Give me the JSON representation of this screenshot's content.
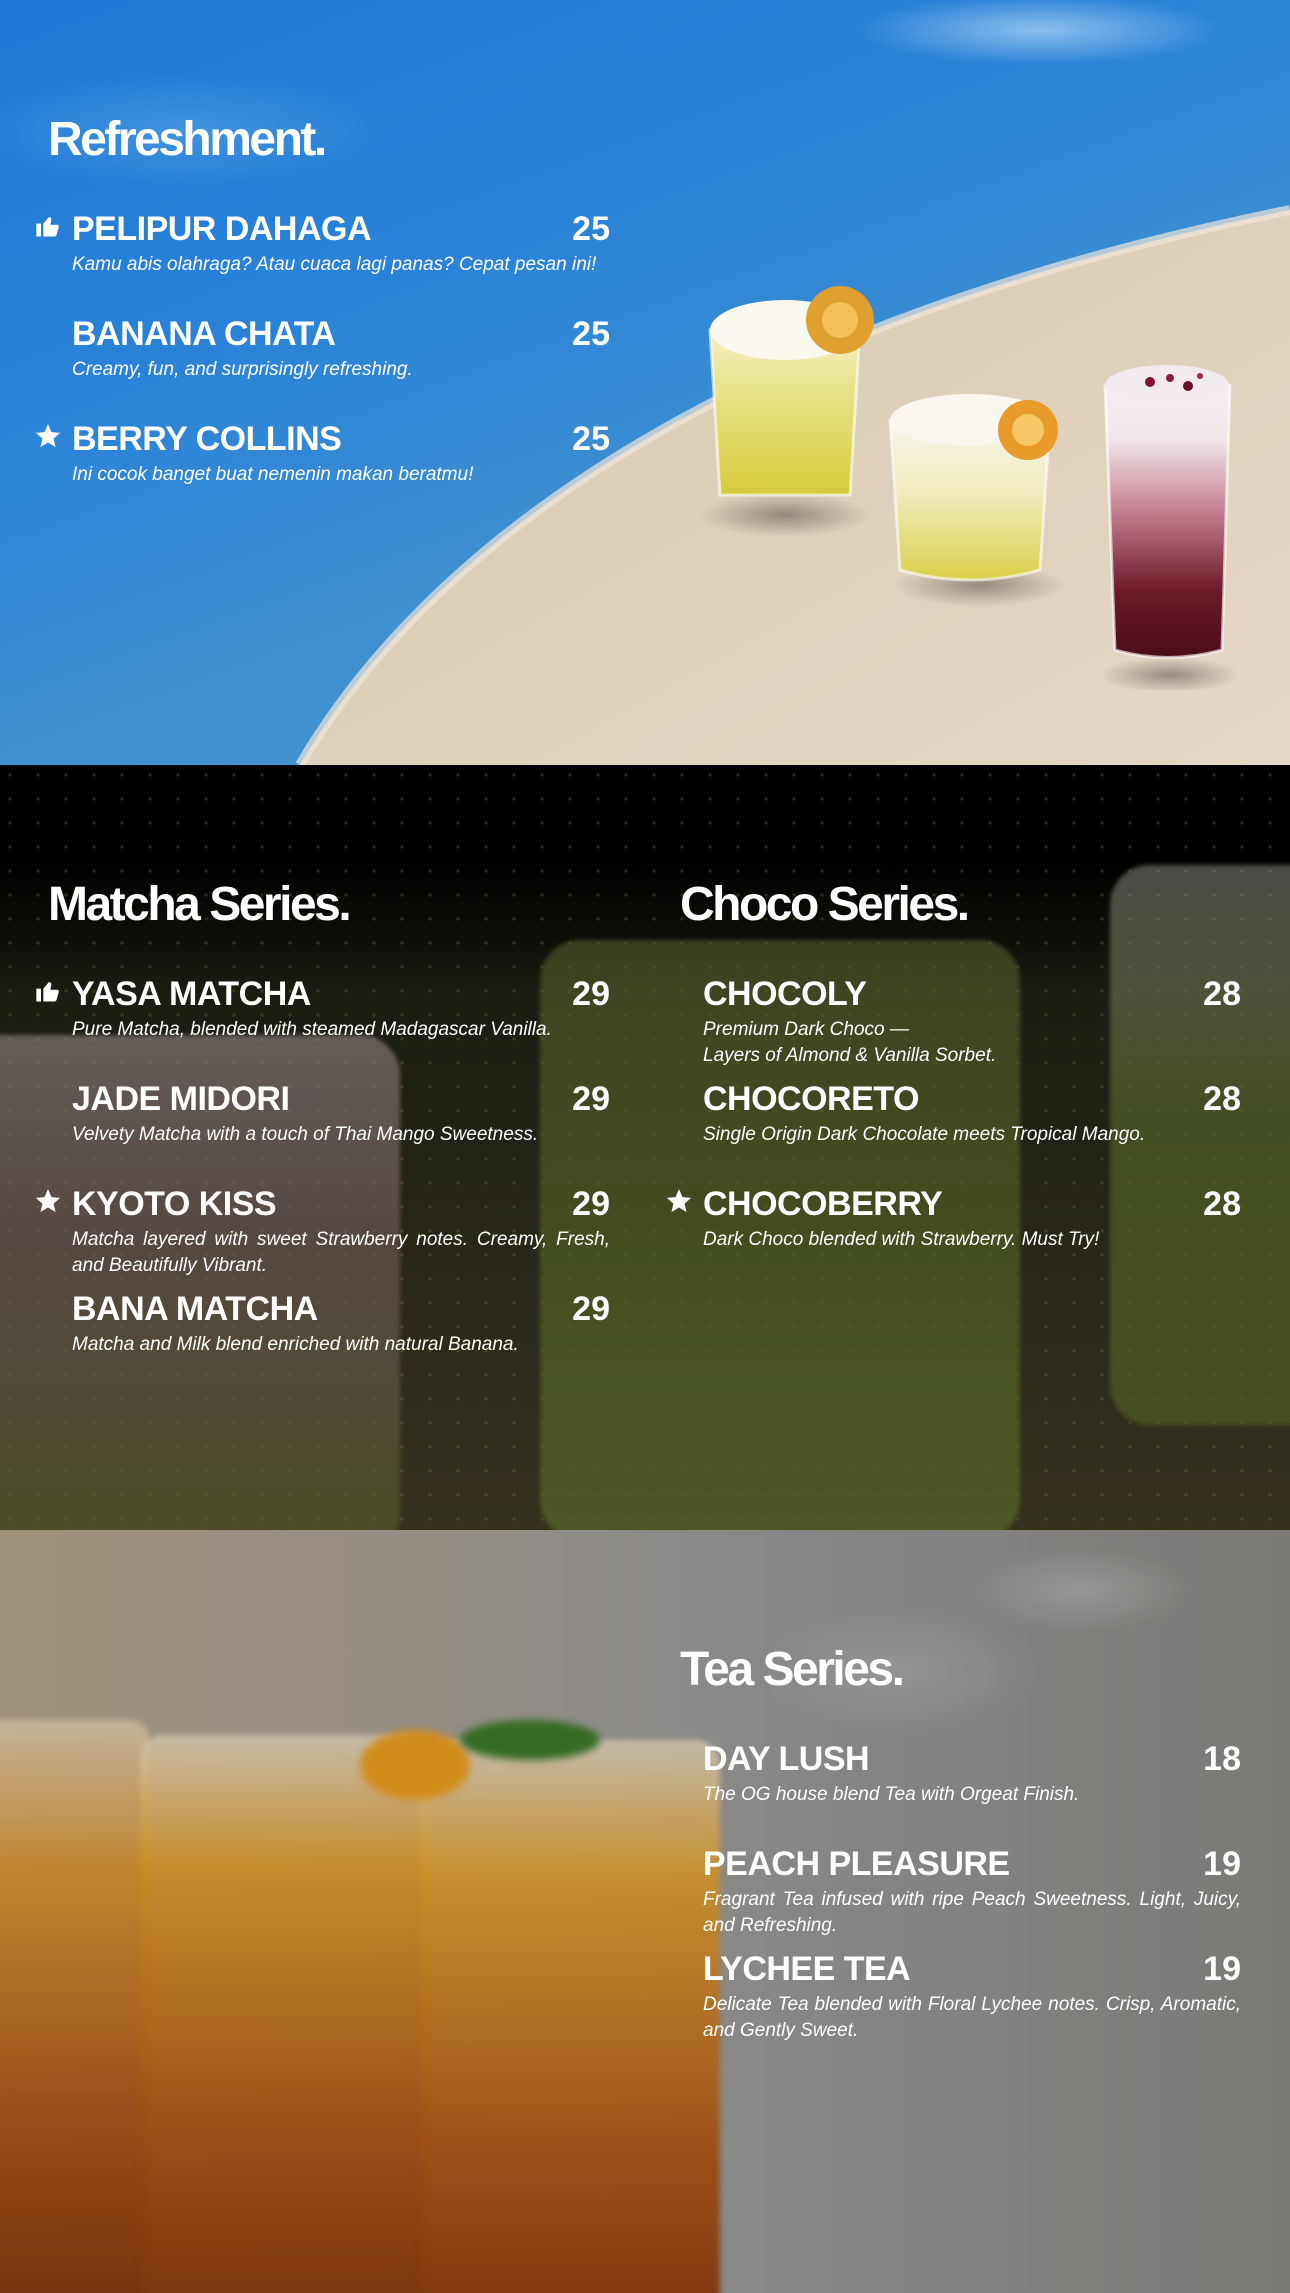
{
  "refreshment": {
    "title": "Refreshment.",
    "items": [
      {
        "name": "PELIPUR DAHAGA",
        "price": "25",
        "desc": "Kamu abis olahraga? Atau cuaca lagi panas? Cepat pesan ini!",
        "badge": "thumbs-up-icon"
      },
      {
        "name": "BANANA CHATA",
        "price": "25",
        "desc": "Creamy, fun, and surprisingly refreshing."
      },
      {
        "name": "BERRY COLLINS",
        "price": "25",
        "desc": "Ini cocok banget buat nemenin makan beratmu!",
        "badge": "star-icon"
      }
    ]
  },
  "matcha": {
    "title": "Matcha Series.",
    "items": [
      {
        "name": "YASA MATCHA",
        "price": "29",
        "desc": "Pure Matcha, blended with steamed Madagascar Vanilla.",
        "badge": "thumbs-up-icon"
      },
      {
        "name": "JADE MIDORI",
        "price": "29",
        "desc": "Velvety Matcha with a touch of Thai Mango Sweetness."
      },
      {
        "name": "KYOTO KISS",
        "price": "29",
        "desc": "Matcha layered with sweet Strawberry notes. Creamy, Fresh, and Beautifully Vibrant.",
        "badge": "star-icon"
      },
      {
        "name": "BANA MATCHA",
        "price": "29",
        "desc": "Matcha and Milk blend enriched with natural Banana."
      }
    ]
  },
  "choco": {
    "title": "Choco Series.",
    "items": [
      {
        "name": "CHOCOLY",
        "price": "28",
        "desc_line1": "Premium Dark Choco —",
        "desc_line2": "Layers of Almond & Vanilla Sorbet."
      },
      {
        "name": "CHOCORETO",
        "price": "28",
        "desc": "Single Origin Dark Chocolate meets Tropical Mango."
      },
      {
        "name": "CHOCOBERRY",
        "price": "28",
        "desc": "Dark Choco blended with Strawberry. Must Try!",
        "badge": "star-icon"
      }
    ]
  },
  "tea": {
    "title": "Tea Series.",
    "items": [
      {
        "name": "DAY LUSH",
        "price": "18",
        "desc": "The OG house blend Tea with Orgeat Finish."
      },
      {
        "name": "PEACH PLEASURE",
        "price": "19",
        "desc": "Fragrant Tea infused with ripe Peach Sweetness. Light, Juicy, and Refreshing."
      },
      {
        "name": "LYCHEE TEA",
        "price": "19",
        "desc": "Delicate Tea blended with Floral Lychee notes. Crisp, Aromatic, and Gently Sweet."
      }
    ]
  },
  "colors": {
    "text": "#ffffff",
    "pool_blue": "#2a83d8",
    "deck_beige": "#d9cbb5",
    "matcha_green": "#6b7a2c",
    "tea_amber": "#c7700f"
  }
}
